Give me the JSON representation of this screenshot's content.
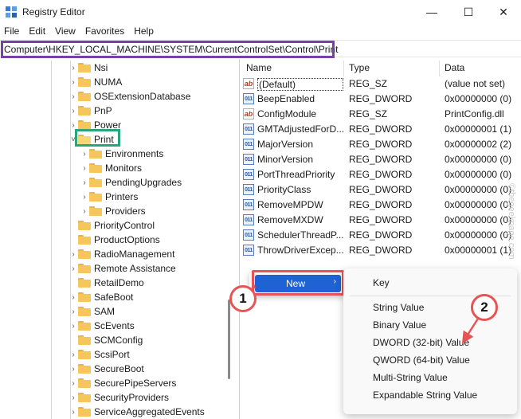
{
  "window": {
    "title": "Registry Editor",
    "minimize_glyph": "—",
    "maximize_glyph": "☐",
    "close_glyph": "✕"
  },
  "menu": [
    "File",
    "Edit",
    "View",
    "Favorites",
    "Help"
  ],
  "address": "Computer\\HKEY_LOCAL_MACHINE\\SYSTEM\\CurrentControlSet\\Control\\Print",
  "tree": [
    {
      "label": "Nsi",
      "level": 0,
      "expander": "›"
    },
    {
      "label": "NUMA",
      "level": 0,
      "expander": "›"
    },
    {
      "label": "OSExtensionDatabase",
      "level": 0,
      "expander": "›"
    },
    {
      "label": "PnP",
      "level": 0,
      "expander": "›"
    },
    {
      "label": "Power",
      "level": 0,
      "expander": "›"
    },
    {
      "label": "Print",
      "level": 0,
      "expander": "˅",
      "open": true
    },
    {
      "label": "Environments",
      "level": 1,
      "expander": "›"
    },
    {
      "label": "Monitors",
      "level": 1,
      "expander": "›"
    },
    {
      "label": "PendingUpgrades",
      "level": 1,
      "expander": "›"
    },
    {
      "label": "Printers",
      "level": 1,
      "expander": "›"
    },
    {
      "label": "Providers",
      "level": 1,
      "expander": "›"
    },
    {
      "label": "PriorityControl",
      "level": 0,
      "expander": ""
    },
    {
      "label": "ProductOptions",
      "level": 0,
      "expander": ""
    },
    {
      "label": "RadioManagement",
      "level": 0,
      "expander": "›"
    },
    {
      "label": "Remote Assistance",
      "level": 0,
      "expander": "›"
    },
    {
      "label": "RetailDemo",
      "level": 0,
      "expander": ""
    },
    {
      "label": "SafeBoot",
      "level": 0,
      "expander": "›"
    },
    {
      "label": "SAM",
      "level": 0,
      "expander": "›"
    },
    {
      "label": "ScEvents",
      "level": 0,
      "expander": "›"
    },
    {
      "label": "SCMConfig",
      "level": 0,
      "expander": ""
    },
    {
      "label": "ScsiPort",
      "level": 0,
      "expander": "›"
    },
    {
      "label": "SecureBoot",
      "level": 0,
      "expander": "›"
    },
    {
      "label": "SecurePipeServers",
      "level": 0,
      "expander": "›"
    },
    {
      "label": "SecurityProviders",
      "level": 0,
      "expander": "›"
    },
    {
      "label": "ServiceAggregatedEvents",
      "level": 0,
      "expander": "›"
    }
  ],
  "columns": {
    "name": "Name",
    "type": "Type",
    "data": "Data"
  },
  "values": [
    {
      "name": "(Default)",
      "type": "REG_SZ",
      "data": "(value not set)",
      "icon": "string-value-icon",
      "glyph": "ab"
    },
    {
      "name": "BeepEnabled",
      "type": "REG_DWORD",
      "data": "0x00000000 (0)",
      "icon": "binary-value-icon",
      "glyph": "011"
    },
    {
      "name": "ConfigModule",
      "type": "REG_SZ",
      "data": "PrintConfig.dll",
      "icon": "string-value-icon",
      "glyph": "ab"
    },
    {
      "name": "GMTAdjustedForD...",
      "type": "REG_DWORD",
      "data": "0x00000001 (1)",
      "icon": "binary-value-icon",
      "glyph": "011"
    },
    {
      "name": "MajorVersion",
      "type": "REG_DWORD",
      "data": "0x00000002 (2)",
      "icon": "binary-value-icon",
      "glyph": "011"
    },
    {
      "name": "MinorVersion",
      "type": "REG_DWORD",
      "data": "0x00000000 (0)",
      "icon": "binary-value-icon",
      "glyph": "011"
    },
    {
      "name": "PortThreadPriority",
      "type": "REG_DWORD",
      "data": "0x00000000 (0)",
      "icon": "binary-value-icon",
      "glyph": "011"
    },
    {
      "name": "PriorityClass",
      "type": "REG_DWORD",
      "data": "0x00000000 (0)",
      "icon": "binary-value-icon",
      "glyph": "011"
    },
    {
      "name": "RemoveMPDW",
      "type": "REG_DWORD",
      "data": "0x00000000 (0)",
      "icon": "binary-value-icon",
      "glyph": "011"
    },
    {
      "name": "RemoveMXDW",
      "type": "REG_DWORD",
      "data": "0x00000000 (0)",
      "icon": "binary-value-icon",
      "glyph": "011"
    },
    {
      "name": "SchedulerThreadP...",
      "type": "REG_DWORD",
      "data": "0x00000000 (0)",
      "icon": "binary-value-icon",
      "glyph": "011"
    },
    {
      "name": "ThrowDriverExcep...",
      "type": "REG_DWORD",
      "data": "0x00000001 (1)",
      "icon": "binary-value-icon",
      "glyph": "011"
    }
  ],
  "context_menu": {
    "new_label": "New",
    "new_arrow": "›",
    "submenu": [
      "Key",
      "String Value",
      "Binary Value",
      "DWORD (32-bit) Value",
      "QWORD (64-bit) Value",
      "Multi-String Value",
      "Expandable String Value"
    ]
  },
  "callouts": {
    "step1": "1",
    "step2": "2"
  },
  "watermark": "©thegeekpage.com",
  "colors": {
    "address_highlight": "#7b3fa8",
    "print_highlight": "#2aa47a",
    "callout": "#e85454",
    "menu_selection": "#1e62d4"
  }
}
